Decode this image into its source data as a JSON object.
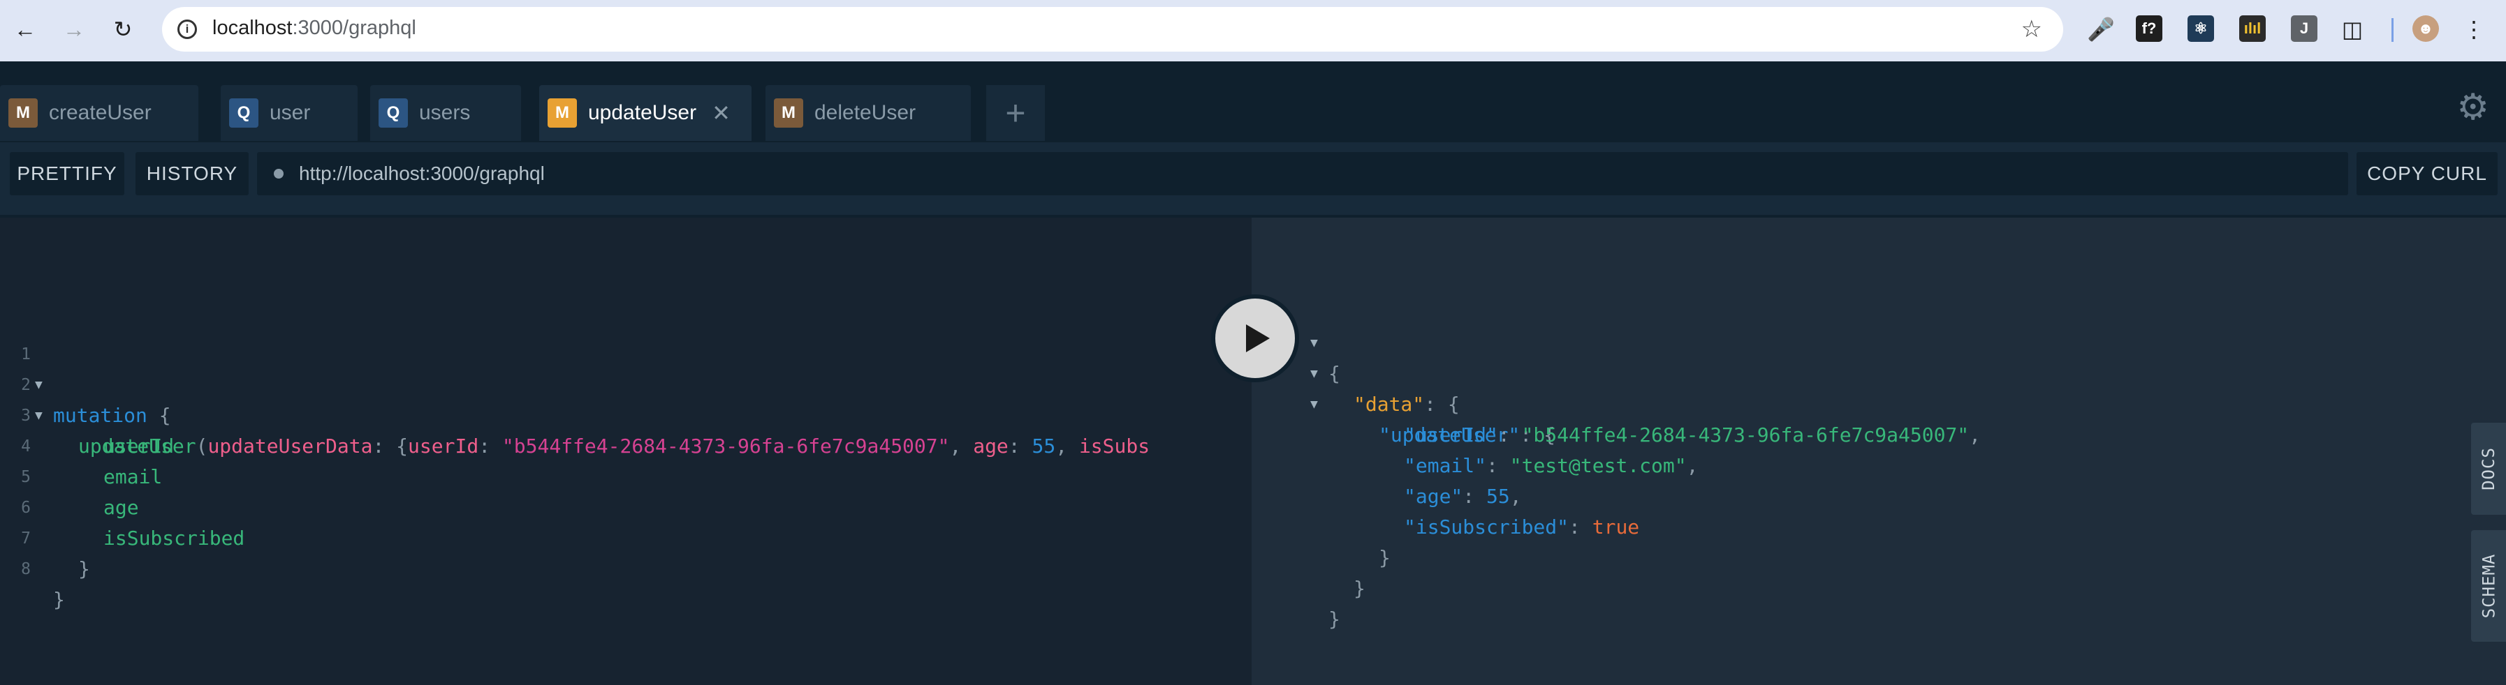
{
  "browser": {
    "url_host": "localhost",
    "url_path": ":3000/graphql",
    "extensions": [
      {
        "name": "f-icon",
        "label": "f?",
        "color": "#1f1f1f"
      },
      {
        "name": "react-icon",
        "label": "⚛",
        "color": "#1f3b57"
      },
      {
        "name": "chart-icon",
        "label": "ılıl",
        "color": "#f2c230"
      },
      {
        "name": "j-icon",
        "label": "J",
        "color": "#5f6368"
      }
    ]
  },
  "tabs": [
    {
      "type": "M",
      "label": "createUser",
      "active": false
    },
    {
      "type": "Q",
      "label": "user",
      "active": false
    },
    {
      "type": "Q",
      "label": "users",
      "active": false
    },
    {
      "type": "M",
      "label": "updateUser",
      "active": true
    },
    {
      "type": "M",
      "label": "deleteUser",
      "active": false
    }
  ],
  "toolbar": {
    "prettify": "PRETTIFY",
    "history": "HISTORY",
    "endpoint": "http://localhost:3000/graphql",
    "copy_curl": "COPY CURL"
  },
  "editor": {
    "line_numbers": [
      "1",
      "2",
      "3",
      "4",
      "5",
      "6",
      "7",
      "8"
    ],
    "l1_kw": "mutation",
    "l1_brace": " {",
    "l2_fn": "updateUser",
    "l2_paren": "(",
    "l2_arg": "updateUserData",
    "l2_colon": ": {",
    "l2_k1": "userId",
    "l2_c1": ": ",
    "l2_v1": "\"b544ffe4-2684-4373-96fa-6fe7c9a45007\"",
    "l2_s1": ", ",
    "l2_k2": "age",
    "l2_c2": ": ",
    "l2_v2": "55",
    "l2_s2": ", ",
    "l2_k3": "isSubs",
    "fields": [
      "userId",
      "email",
      "age",
      "isSubscribed"
    ],
    "close_inner": "}",
    "close_outer": "}"
  },
  "result": {
    "open": "{",
    "data_key": "\"data\"",
    "data_open": ": {",
    "update_key": "\"updateUser\"",
    "update_open": ": {",
    "userId_key": "\"userId\"",
    "userId_val": "\"b544ffe4-2684-4373-96fa-6fe7c9a45007\"",
    "email_key": "\"email\"",
    "email_val": "\"test@test.com\"",
    "age_key": "\"age\"",
    "age_val": "55",
    "sub_key": "\"isSubscribed\"",
    "sub_val": "true",
    "close": "}"
  },
  "side": {
    "docs": "DOCS",
    "schema": "SCHEMA"
  }
}
